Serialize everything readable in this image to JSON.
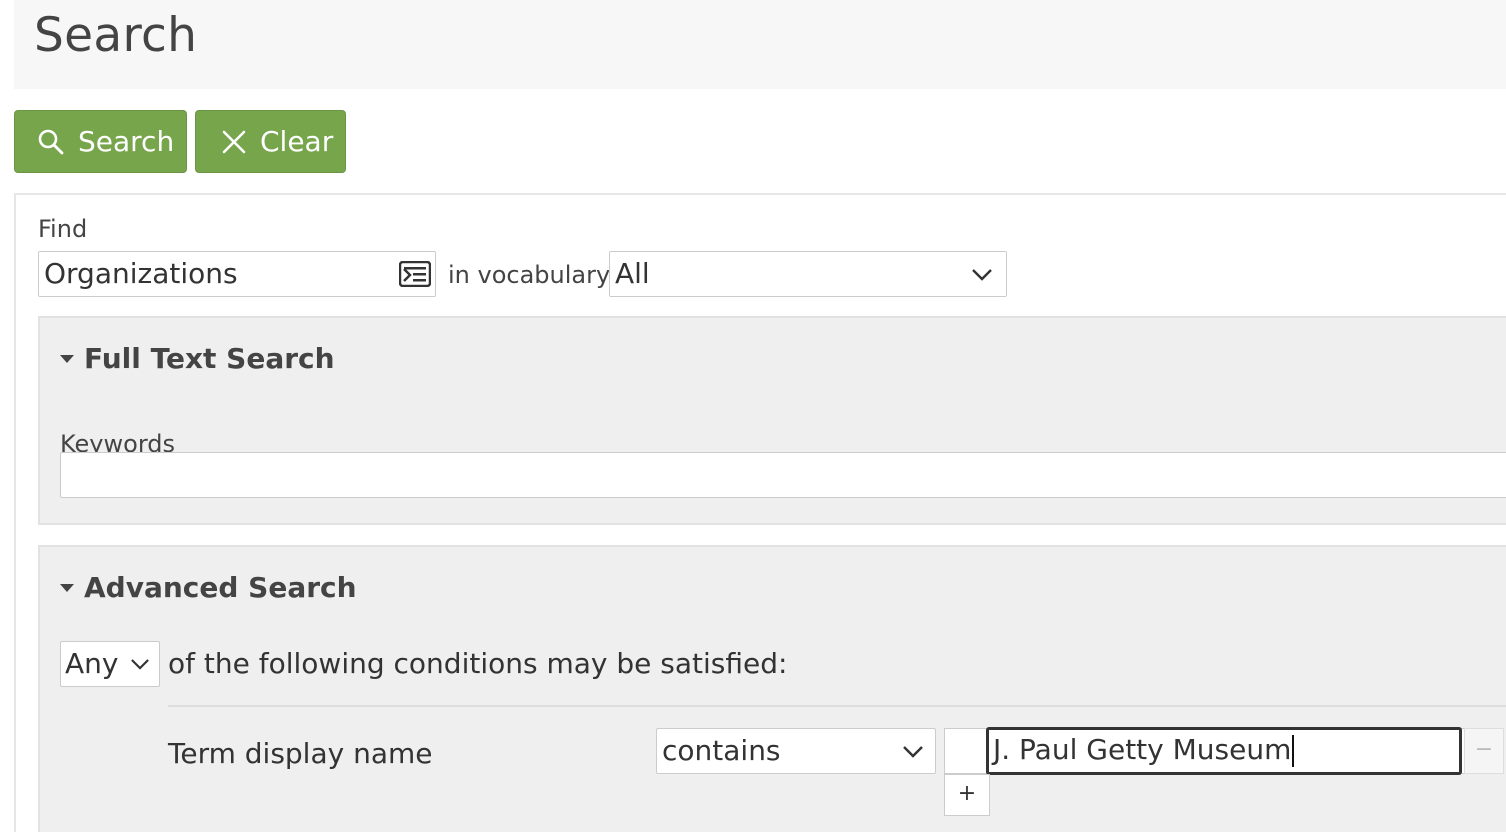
{
  "header": {
    "title": "Search"
  },
  "toolbar": {
    "search_label": "Search",
    "clear_label": "Clear"
  },
  "find": {
    "label": "Find",
    "record_type": "Organizations",
    "in_vocabulary_label": "in vocabulary",
    "vocabulary": "All"
  },
  "full_text": {
    "heading": "Full Text Search",
    "keywords_label": "Keywords",
    "keywords_value": ""
  },
  "advanced": {
    "heading": "Advanced Search",
    "boolean_op": "Any",
    "conditions_text": "of the following conditions may be satisfied:",
    "condition": {
      "field_label": "Term display name",
      "operator": "contains",
      "value": "J. Paul Getty Museum",
      "remove_label": "−",
      "add_label": "+"
    }
  },
  "colors": {
    "button_green": "#76a54c",
    "panel_bg": "#efefef",
    "header_bg": "#f7f7f7"
  },
  "icons": {
    "search": "search-icon",
    "clear": "close-icon",
    "record_picker": "record-picker-icon",
    "dropdown": "chevron-down-icon",
    "collapse": "caret-down-icon"
  }
}
